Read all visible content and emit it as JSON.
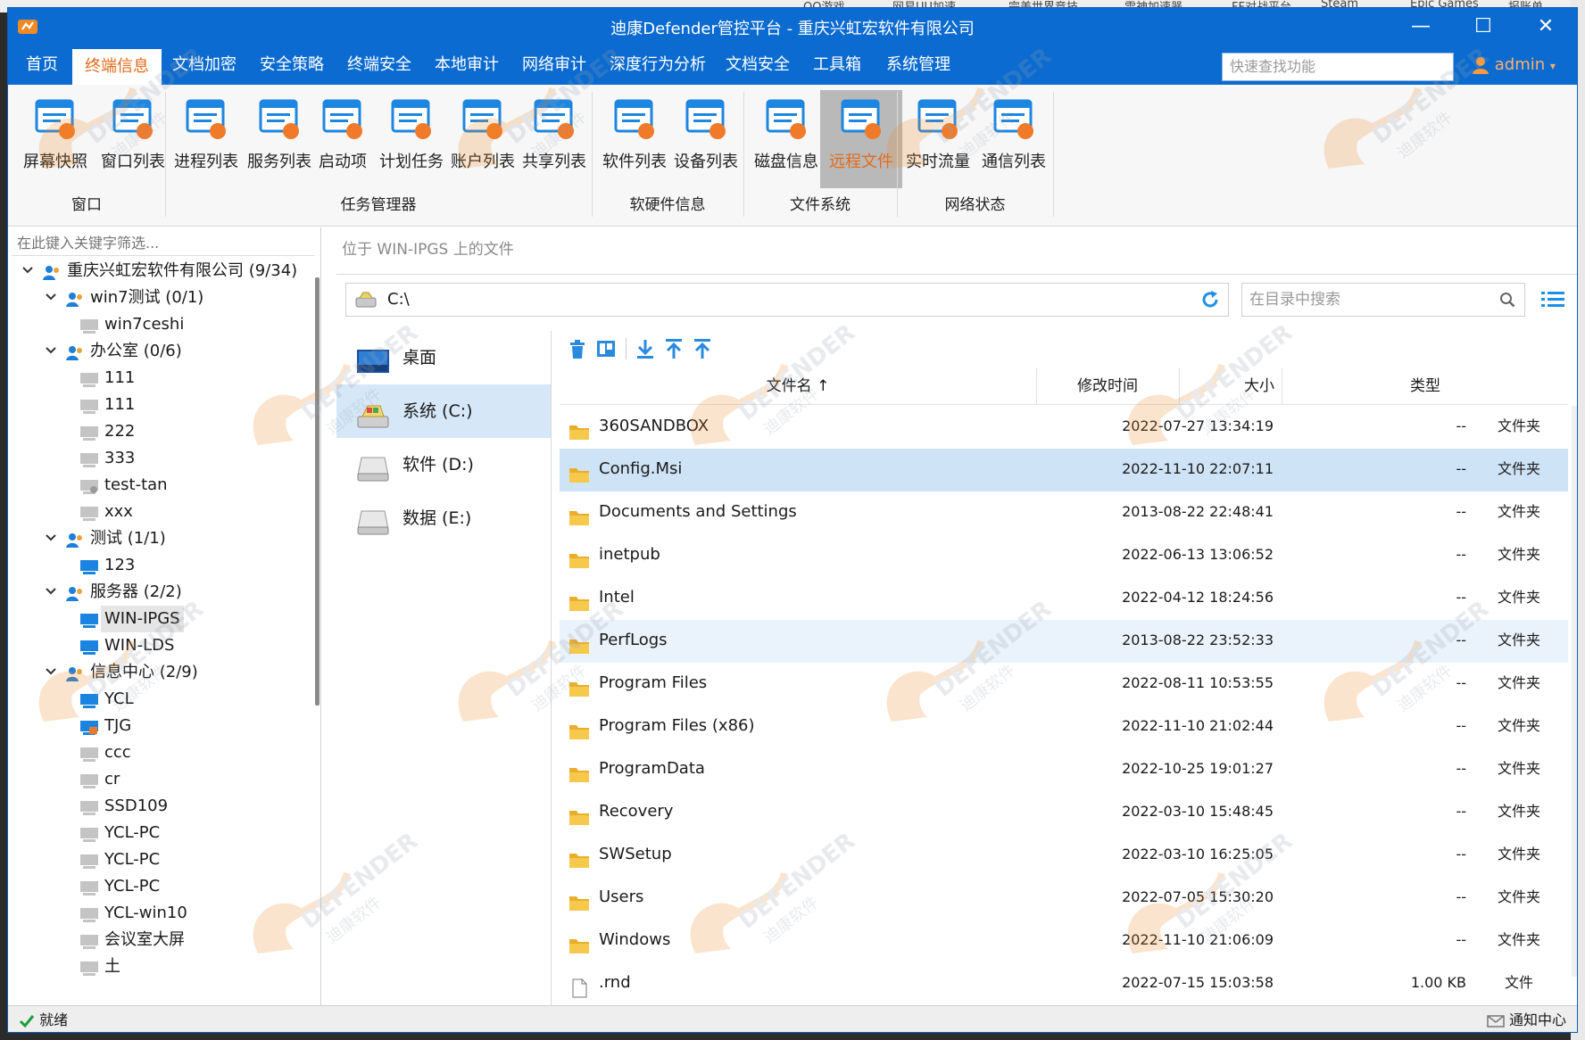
{
  "desktop": {
    "taskbar_items": [
      "QQ游戏",
      "网易UU加速",
      "完美世界竞技",
      "雷神加速器",
      "FF对战平台",
      "Steam",
      "Epic Games",
      "报账单"
    ]
  },
  "window": {
    "title": "迪康Defender管控平台 - 重庆兴虹宏软件有限公司",
    "min_glyph": "—",
    "max_glyph": "☐",
    "close_glyph": "✕"
  },
  "menu": {
    "items": [
      "首页",
      "终端信息",
      "文档加密",
      "安全策略",
      "终端安全",
      "本地审计",
      "网络审计",
      "深度行为分析",
      "文档安全",
      "工具箱",
      "系统管理"
    ],
    "active": "终端信息",
    "quick_search_placeholder": "快速查找功能",
    "user": "admin",
    "user_caret": "▾"
  },
  "ribbon": {
    "buttons": [
      {
        "label": "屏幕快照",
        "icon": "screenshot-icon"
      },
      {
        "label": "窗口列表",
        "icon": "window-list-icon"
      },
      {
        "label": "进程列表",
        "icon": "process-list-icon"
      },
      {
        "label": "服务列表",
        "icon": "service-list-icon"
      },
      {
        "label": "启动项",
        "icon": "startup-icon"
      },
      {
        "label": "计划任务",
        "icon": "scheduled-task-icon"
      },
      {
        "label": "账户列表",
        "icon": "account-list-icon"
      },
      {
        "label": "共享列表",
        "icon": "share-list-icon"
      },
      {
        "label": "软件列表",
        "icon": "software-list-icon"
      },
      {
        "label": "设备列表",
        "icon": "device-list-icon"
      },
      {
        "label": "磁盘信息",
        "icon": "disk-info-icon"
      },
      {
        "label": "远程文件",
        "icon": "remote-file-icon",
        "active": true
      },
      {
        "label": "实时流量",
        "icon": "realtime-traffic-icon"
      },
      {
        "label": "通信列表",
        "icon": "connection-list-icon"
      }
    ],
    "groups": [
      "窗口",
      "任务管理器",
      "软硬件信息",
      "文件系统",
      "网络状态"
    ]
  },
  "tree": {
    "filter_placeholder": "在此键入关键字筛选...",
    "nodes": [
      {
        "label": "重庆兴虹宏软件有限公司 (9/34)",
        "level": 0,
        "type": "group",
        "expanded": true
      },
      {
        "label": "win7测试 (0/1)",
        "level": 1,
        "type": "group",
        "expanded": true
      },
      {
        "label": "win7ceshi",
        "level": 2,
        "type": "offline"
      },
      {
        "label": "办公室 (0/6)",
        "level": 1,
        "type": "group",
        "expanded": true
      },
      {
        "label": "111",
        "level": 2,
        "type": "offline"
      },
      {
        "label": "111",
        "level": 2,
        "type": "offline"
      },
      {
        "label": "222",
        "level": 2,
        "type": "offline"
      },
      {
        "label": "333",
        "level": 2,
        "type": "offline"
      },
      {
        "label": "test-tan",
        "level": 2,
        "type": "offline-special"
      },
      {
        "label": "xxx",
        "level": 2,
        "type": "offline"
      },
      {
        "label": "测试 (1/1)",
        "level": 1,
        "type": "group",
        "expanded": true
      },
      {
        "label": "123",
        "level": 2,
        "type": "online"
      },
      {
        "label": "服务器 (2/2)",
        "level": 1,
        "type": "group",
        "expanded": true
      },
      {
        "label": "WIN-IPGS",
        "level": 2,
        "type": "online",
        "selected": true
      },
      {
        "label": "WIN-LDS",
        "level": 2,
        "type": "online"
      },
      {
        "label": "信息中心 (2/9)",
        "level": 1,
        "type": "group",
        "expanded": true
      },
      {
        "label": "YCL",
        "level": 2,
        "type": "online"
      },
      {
        "label": "TJG",
        "level": 2,
        "type": "online-locked"
      },
      {
        "label": "ccc",
        "level": 2,
        "type": "offline"
      },
      {
        "label": "cr",
        "level": 2,
        "type": "offline"
      },
      {
        "label": "SSD109",
        "level": 2,
        "type": "offline"
      },
      {
        "label": "YCL-PC",
        "level": 2,
        "type": "offline"
      },
      {
        "label": "YCL-PC",
        "level": 2,
        "type": "offline"
      },
      {
        "label": "YCL-PC",
        "level": 2,
        "type": "offline"
      },
      {
        "label": "YCL-win10",
        "level": 2,
        "type": "offline"
      },
      {
        "label": "会议室大屏",
        "level": 2,
        "type": "offline"
      },
      {
        "label": "土",
        "level": 2,
        "type": "offline"
      }
    ]
  },
  "file_browser": {
    "location_label": "位于 WIN-IPGS 上的文件",
    "path": "C:\\",
    "search_placeholder": "在目录中搜索",
    "drives": [
      {
        "label": "桌面",
        "icon": "desktop-icon"
      },
      {
        "label": "系统 (C:)",
        "icon": "system-drive-icon",
        "selected": true
      },
      {
        "label": "软件 (D:)",
        "icon": "drive-icon"
      },
      {
        "label": "数据 (E:)",
        "icon": "drive-icon"
      }
    ],
    "columns": {
      "name": "文件名 ↑",
      "modified": "修改时间",
      "size": "大小",
      "type": "类型"
    },
    "files": [
      {
        "name": "360SANDBOX",
        "modified": "2022-07-27 13:34:19",
        "size": "--",
        "type": "文件夹",
        "kind": "folder"
      },
      {
        "name": "Config.Msi",
        "modified": "2022-11-10 22:07:11",
        "size": "--",
        "type": "文件夹",
        "kind": "folder",
        "state": "selected"
      },
      {
        "name": "Documents and Settings",
        "modified": "2013-08-22 22:48:41",
        "size": "--",
        "type": "文件夹",
        "kind": "folder"
      },
      {
        "name": "inetpub",
        "modified": "2022-06-13 13:06:52",
        "size": "--",
        "type": "文件夹",
        "kind": "folder"
      },
      {
        "name": "Intel",
        "modified": "2022-04-12 18:24:56",
        "size": "--",
        "type": "文件夹",
        "kind": "folder"
      },
      {
        "name": "PerfLogs",
        "modified": "2013-08-22 23:52:33",
        "size": "--",
        "type": "文件夹",
        "kind": "folder",
        "state": "hover"
      },
      {
        "name": "Program Files",
        "modified": "2022-08-11 10:53:55",
        "size": "--",
        "type": "文件夹",
        "kind": "folder"
      },
      {
        "name": "Program Files (x86)",
        "modified": "2022-11-10 21:02:44",
        "size": "--",
        "type": "文件夹",
        "kind": "folder"
      },
      {
        "name": "ProgramData",
        "modified": "2022-10-25 19:01:27",
        "size": "--",
        "type": "文件夹",
        "kind": "folder"
      },
      {
        "name": "Recovery",
        "modified": "2022-03-10 15:48:45",
        "size": "--",
        "type": "文件夹",
        "kind": "folder"
      },
      {
        "name": "SWSetup",
        "modified": "2022-03-10 16:25:05",
        "size": "--",
        "type": "文件夹",
        "kind": "folder"
      },
      {
        "name": "Users",
        "modified": "2022-07-05 15:30:20",
        "size": "--",
        "type": "文件夹",
        "kind": "folder"
      },
      {
        "name": "Windows",
        "modified": "2022-11-10 21:06:09",
        "size": "--",
        "type": "文件夹",
        "kind": "folder"
      },
      {
        "name": ".rnd",
        "modified": "2022-07-15 15:03:58",
        "size": "1.00 KB",
        "type": "文件",
        "kind": "file"
      }
    ]
  },
  "status": {
    "ready": "就绪",
    "notification_center": "通知中心"
  },
  "watermark": {
    "text": "DEFENDER",
    "sub": "迪康软件"
  },
  "colors": {
    "title_blue": "#0b6bd0",
    "accent_orange": "#e36b1b",
    "selected_row": "#cfe3f7",
    "folder_yellow": "#f5c242"
  }
}
